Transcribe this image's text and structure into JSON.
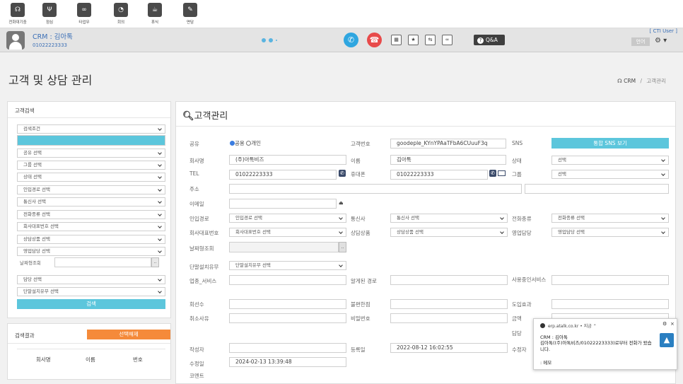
{
  "toolbar": {
    "items": [
      {
        "label": "전화대기중",
        "icon": "headset-icon"
      },
      {
        "label": "점심",
        "icon": "fork-knife-icon"
      },
      {
        "label": "타업무",
        "icon": "link-icon"
      },
      {
        "label": "회의",
        "icon": "clock-icon"
      },
      {
        "label": "휴식",
        "icon": "coffee-icon"
      },
      {
        "label": "면담",
        "icon": "pencil-icon"
      }
    ]
  },
  "header": {
    "crm_name": "CRM : 김아톡",
    "phone": "01022223333",
    "qa_label": "Q&A",
    "cti_user": "[ CTI User ]",
    "lang": "언어"
  },
  "page": {
    "title": "고객 및 상담 관리",
    "crumb_home": "CRM",
    "crumb_sep": "/",
    "crumb_current": "고객관리"
  },
  "left": {
    "search_title": "고객검색",
    "selects": [
      "검색조건",
      "",
      "공유 선택",
      "그룹 선택",
      "상태 선택",
      "인입경로 선택",
      "통신사 선택",
      "전화종류 선택",
      "회사대표번호 선택",
      "상담상품 선택",
      "영업담당 선택"
    ],
    "date_label": "날짜형조회",
    "date_btn": "..",
    "selects2": [
      "담당 선택",
      "단말설치유무 선택"
    ],
    "search_btn": "검색",
    "results_title": "검색결과",
    "deselect_btn": "선택해제",
    "cols": [
      "회사명",
      "이름",
      "번호"
    ]
  },
  "form": {
    "title": "고객관리",
    "share_label": "공유",
    "share_public": "공용",
    "share_private": "개인",
    "custno_label": "고객번호",
    "custno_value": "goodeple_KYnYPAaTFbA6CUuuF3q",
    "sns_label": "SNS",
    "sns_btn": "통합 SNS 보기",
    "company_label": "회사명",
    "company_value": "(주)아톡비즈",
    "name_label": "이름",
    "name_value": "김아톡",
    "status_label": "상태",
    "status_value": "선택",
    "tel_label": "TEL",
    "tel_value": "01022223333",
    "mobile_label": "휴대폰",
    "mobile_value": "01022223333",
    "group_label": "그룹",
    "group_value": "선택",
    "addr_label": "주소",
    "email_label": "이메일",
    "inflow_label": "인입경로",
    "inflow_value": "인입경로 선택",
    "carrier_label": "통신사",
    "carrier_value": "통신사 선택",
    "phonetype_label": "전화종류",
    "phonetype_value": "전화종류 선택",
    "rep_label": "회사대표번호",
    "rep_value": "회사대표번호 선택",
    "product_label": "상담상품",
    "product_value": "상담상품 선택",
    "sales_label": "영업담당",
    "sales_value": "영업담당 선택",
    "date_label": "날짜형조회",
    "date_btn": "..",
    "terminal_label": "단말설치유무",
    "terminal_value": "단말설치유무 선택",
    "biz_label": "업종_서비스",
    "known_label": "알게된 경로",
    "service_label": "사용중인서비스",
    "lines_label": "회선수",
    "complaint_label": "불편한점",
    "effect_label": "도입효과",
    "cancel_label": "취소사유",
    "pw_label": "비밀번호",
    "amount_label": "금액",
    "manager_label": "담당",
    "author_label": "작성자",
    "regdate_label": "등록일",
    "regdate_value": "2022-08-12 16:02:55",
    "editor_label": "수정자",
    "moddate_label": "수정일",
    "moddate_value": "2024-02-13 13:39:48",
    "comment_label": "코멘트"
  },
  "notify": {
    "site": "erp.atalk.co.kr",
    "dot": "•",
    "time": "지금",
    "line1": "CRM : 김아톡",
    "line2": "김아톡((주)아톡비즈/01022223333)로부터 전화가 왔습니다.",
    "line3": ": 메모"
  }
}
